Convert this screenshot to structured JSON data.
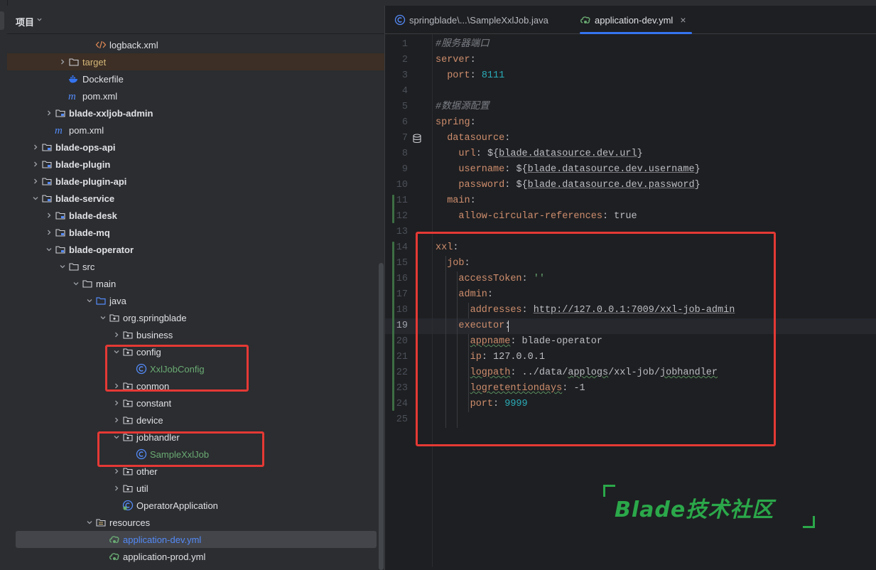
{
  "project_panel": {
    "title": "项目",
    "tree": [
      {
        "label": "logback.xml",
        "icon": "xml-icon",
        "indent": 6,
        "chevron": "none",
        "style": "normal"
      },
      {
        "label": "target",
        "icon": "folder-icon",
        "indent": 4,
        "chevron": "right",
        "style": "orange",
        "highlight": true
      },
      {
        "label": "Dockerfile",
        "icon": "docker-icon",
        "indent": 4,
        "chevron": "none",
        "style": "normal"
      },
      {
        "label": "pom.xml",
        "icon": "maven-icon",
        "indent": 4,
        "chevron": "none",
        "style": "normal"
      },
      {
        "label": "blade-xxljob-admin",
        "icon": "module-icon",
        "indent": 3,
        "chevron": "right",
        "style": "bold"
      },
      {
        "label": "pom.xml",
        "icon": "maven-icon",
        "indent": 3,
        "chevron": "none",
        "style": "normal"
      },
      {
        "label": "blade-ops-api",
        "icon": "module-icon",
        "indent": 2,
        "chevron": "right",
        "style": "bold"
      },
      {
        "label": "blade-plugin",
        "icon": "module-icon",
        "indent": 2,
        "chevron": "right",
        "style": "bold"
      },
      {
        "label": "blade-plugin-api",
        "icon": "module-icon",
        "indent": 2,
        "chevron": "right",
        "style": "bold"
      },
      {
        "label": "blade-service",
        "icon": "module-icon",
        "indent": 2,
        "chevron": "down",
        "style": "bold"
      },
      {
        "label": "blade-desk",
        "icon": "module-icon",
        "indent": 3,
        "chevron": "right",
        "style": "bold"
      },
      {
        "label": "blade-mq",
        "icon": "module-icon",
        "indent": 3,
        "chevron": "right",
        "style": "bold"
      },
      {
        "label": "blade-operator",
        "icon": "module-icon",
        "indent": 3,
        "chevron": "down",
        "style": "bold"
      },
      {
        "label": "src",
        "icon": "folder-icon",
        "indent": 4,
        "chevron": "down",
        "style": "normal"
      },
      {
        "label": "main",
        "icon": "folder-icon",
        "indent": 5,
        "chevron": "down",
        "style": "normal"
      },
      {
        "label": "java",
        "icon": "source-folder-icon",
        "indent": 6,
        "chevron": "down",
        "style": "normal"
      },
      {
        "label": "org.springblade",
        "icon": "package-icon",
        "indent": 7,
        "chevron": "down",
        "style": "normal"
      },
      {
        "label": "business",
        "icon": "package-icon",
        "indent": 8,
        "chevron": "right",
        "style": "normal"
      },
      {
        "label": "config",
        "icon": "package-icon",
        "indent": 8,
        "chevron": "down",
        "style": "normal"
      },
      {
        "label": "XxlJobConfig",
        "icon": "class-icon",
        "indent": 9,
        "chevron": "none",
        "style": "green"
      },
      {
        "label": "conmon",
        "icon": "package-icon",
        "indent": 8,
        "chevron": "right",
        "style": "normal"
      },
      {
        "label": "constant",
        "icon": "package-icon",
        "indent": 8,
        "chevron": "right",
        "style": "normal"
      },
      {
        "label": "device",
        "icon": "package-icon",
        "indent": 8,
        "chevron": "right",
        "style": "normal"
      },
      {
        "label": "jobhandler",
        "icon": "package-icon",
        "indent": 8,
        "chevron": "down",
        "style": "normal"
      },
      {
        "label": "SampleXxlJob",
        "icon": "class-icon",
        "indent": 9,
        "chevron": "none",
        "style": "green"
      },
      {
        "label": "other",
        "icon": "package-icon",
        "indent": 8,
        "chevron": "right",
        "style": "normal"
      },
      {
        "label": "util",
        "icon": "package-icon",
        "indent": 8,
        "chevron": "right",
        "style": "normal"
      },
      {
        "label": "OperatorApplication",
        "icon": "spring-class-icon",
        "indent": 8,
        "chevron": "none",
        "style": "normal"
      },
      {
        "label": "resources",
        "icon": "resources-folder-icon",
        "indent": 6,
        "chevron": "down",
        "style": "normal"
      },
      {
        "label": "application-dev.yml",
        "icon": "yaml-icon",
        "indent": 7,
        "chevron": "none",
        "style": "blue",
        "selected": true
      },
      {
        "label": "application-prod.yml",
        "icon": "yaml-icon",
        "indent": 7,
        "chevron": "none",
        "style": "normal"
      }
    ]
  },
  "editor": {
    "tabs": [
      {
        "label": "springblade\\...\\SampleXxlJob.java",
        "icon": "class-icon",
        "active": false
      },
      {
        "label": "application-dev.yml",
        "icon": "yaml-icon",
        "active": true,
        "close": "×"
      }
    ],
    "current_line": 19,
    "lines": [
      {
        "no": "1",
        "text": "#服务器端口"
      },
      {
        "no": "2",
        "text": "server:"
      },
      {
        "no": "3",
        "text": "  port: 8111"
      },
      {
        "no": "4",
        "text": ""
      },
      {
        "no": "5",
        "text": "#数据源配置"
      },
      {
        "no": "6",
        "text": "spring:"
      },
      {
        "no": "7",
        "text": "  datasource:"
      },
      {
        "no": "8",
        "text": "    url: ${blade.datasource.dev.url}"
      },
      {
        "no": "9",
        "text": "    username: ${blade.datasource.dev.username}"
      },
      {
        "no": "10",
        "text": "    password: ${blade.datasource.dev.password}"
      },
      {
        "no": "11",
        "text": "  main:"
      },
      {
        "no": "12",
        "text": "    allow-circular-references: true"
      },
      {
        "no": "13",
        "text": ""
      },
      {
        "no": "14",
        "text": "xxl:"
      },
      {
        "no": "15",
        "text": "  job:"
      },
      {
        "no": "16",
        "text": "    accessToken: ''"
      },
      {
        "no": "17",
        "text": "    admin:"
      },
      {
        "no": "18",
        "text": "      addresses: http://127.0.0.1:7009/xxl-job-admin"
      },
      {
        "no": "19",
        "text": "    executor:"
      },
      {
        "no": "20",
        "text": "      appname: blade-operator"
      },
      {
        "no": "21",
        "text": "      ip: 127.0.0.1"
      },
      {
        "no": "22",
        "text": "      logpath: ../data/applogs/xxl-job/jobhandler"
      },
      {
        "no": "23",
        "text": "      logretentiondays: -1"
      },
      {
        "no": "24",
        "text": "      port: 9999"
      },
      {
        "no": "25",
        "text": ""
      }
    ]
  },
  "watermark": {
    "text": "Blade技术社区"
  },
  "colors": {
    "highlight_red": "#e53935",
    "accent_blue": "#3574f0",
    "watermark_green": "#2ba84a",
    "yaml_key": "#cf8e6d",
    "number": "#2aacb8",
    "comment": "#7a7e85"
  }
}
